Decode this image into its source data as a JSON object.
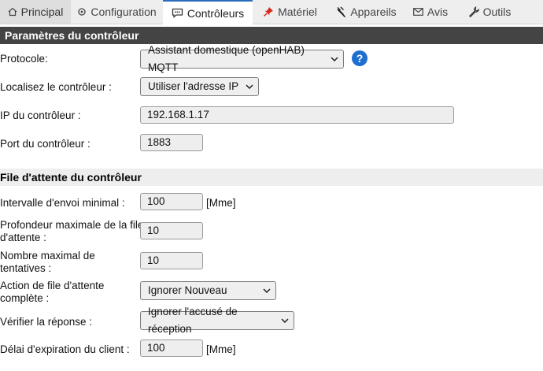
{
  "tabs": [
    {
      "label": "Principal",
      "icon": "home-icon"
    },
    {
      "label": "Configuration",
      "icon": "gear-icon"
    },
    {
      "label": "Contrôleurs",
      "icon": "chat-icon"
    },
    {
      "label": "Matériel",
      "icon": "pin-icon"
    },
    {
      "label": "Appareils",
      "icon": "plug-icon"
    },
    {
      "label": "Avis",
      "icon": "mail-icon"
    },
    {
      "label": "Outils",
      "icon": "wrench-icon"
    }
  ],
  "active_tab": "Contrôleurs",
  "sections": {
    "controller": "Paramètres du contrôleur",
    "queue": "File d'attente du contrôleur"
  },
  "fields": {
    "protocol": {
      "label": "Protocole:",
      "value": "Assistant domestique (openHAB) MQTT"
    },
    "locate": {
      "label": "Localisez le contrôleur :",
      "value": "Utiliser l'adresse IP"
    },
    "ip": {
      "label": "IP du contrôleur :",
      "value": "192.168.1.17"
    },
    "port": {
      "label": "Port du contrôleur :",
      "value": "1883"
    },
    "min_interval": {
      "label": "Intervalle d'envoi minimal :",
      "value": "100",
      "unit": "[Mme]"
    },
    "max_queue_l1": {
      "label_line1": "Profondeur maximale de la file",
      "label_line2": "d'attente :",
      "value": "10"
    },
    "max_retries": {
      "label_line1": "Nombre maximal de",
      "label_line2": "tentatives :",
      "value": "10"
    },
    "queue_full": {
      "label_line1": "Action de file d'attente",
      "label_line2": "complète :",
      "value": "Ignorer Nouveau"
    },
    "check_reply": {
      "label": "Vérifier la réponse :",
      "value": "Ignorer l'accusé de réception"
    },
    "client_timeout": {
      "label": "Délai d'expiration du client :",
      "value": "100",
      "unit": "[Mme]"
    }
  },
  "help_label": "?",
  "colors": {
    "accent": "#2a6ebb",
    "help": "#1f6fd1",
    "section_dark": "#444444"
  }
}
